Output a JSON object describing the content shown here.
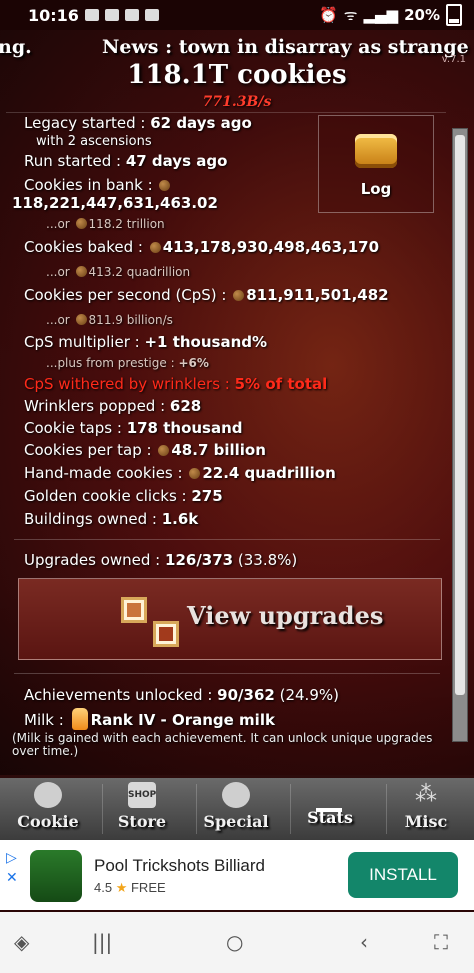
{
  "status_bar": {
    "time": "10:16",
    "battery": "20%"
  },
  "news": {
    "left_fragment": "ng.",
    "headline": "News : town in disarray as strange old"
  },
  "version": "v.7.1",
  "header": {
    "cookies": "118.1T cookies",
    "cps": "771.3B/s"
  },
  "log": {
    "label": "Log"
  },
  "stats": {
    "legacy_started_label": "Legacy started : ",
    "legacy_started_value": "62 days ago",
    "ascensions": "with 2 ascensions",
    "run_started_label": "Run started : ",
    "run_started_value": "47 days ago",
    "bank_label": "Cookies in bank : ",
    "bank_value": "118,221,447,631,463.02",
    "bank_or": "...or ",
    "bank_short": "118.2 trillion",
    "baked_label": "Cookies baked : ",
    "baked_value": "413,178,930,498,463,170",
    "baked_or": "...or ",
    "baked_short": "413.2 quadrillion",
    "cps_label": "Cookies per second (CpS) : ",
    "cps_value": "811,911,501,482",
    "cps_or": "...or ",
    "cps_short": "811.9 billion/s",
    "mult_label": "CpS multiplier : ",
    "mult_value": "+1 thousand%",
    "prestige_label": "...plus from prestige : ",
    "prestige_value": "+6%",
    "wither_label": "CpS withered by wrinklers : ",
    "wither_value": "5% of total",
    "wrinklers_label": "Wrinklers popped : ",
    "wrinklers_value": "628",
    "taps_label": "Cookie taps : ",
    "taps_value": "178 thousand",
    "per_tap_label": "Cookies per tap : ",
    "per_tap_value": "48.7 billion",
    "handmade_label": "Hand-made cookies : ",
    "handmade_value": "22.4 quadrillion",
    "golden_label": "Golden cookie clicks : ",
    "golden_value": "275",
    "buildings_label": "Buildings owned : ",
    "buildings_value": "1.6k",
    "upgrades_label": "Upgrades owned : ",
    "upgrades_value": "126/373",
    "upgrades_pct": " (33.8%)",
    "achievements_label": "Achievements unlocked : ",
    "achievements_value": "90/362",
    "achievements_pct": " (24.9%)",
    "milk_label": "Milk : ",
    "milk_value": "Rank IV - Orange milk",
    "milk_note": "(Milk is gained with each achievement. It can unlock unique upgrades over time.)"
  },
  "view_upgrades": "View upgrades",
  "tabs": [
    "Cookie",
    "Store",
    "Special",
    "Stats",
    "Misc"
  ],
  "shop_badge": "SHOP",
  "ad": {
    "title": "Pool Trickshots Billiard",
    "rating": "4.5",
    "price": "FREE",
    "button": "INSTALL"
  }
}
